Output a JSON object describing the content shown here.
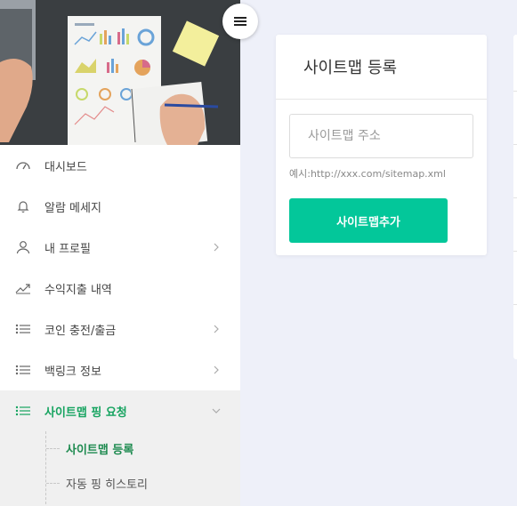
{
  "sidebar": {
    "items": [
      {
        "label": "대시보드",
        "icon": "dashboard-gauge-icon",
        "has_chevron": false
      },
      {
        "label": "알람 메세지",
        "icon": "bell-icon",
        "has_chevron": false
      },
      {
        "label": "내 프로필",
        "icon": "user-icon",
        "has_chevron": true
      },
      {
        "label": "수익지출 내역",
        "icon": "trend-line-icon",
        "has_chevron": false
      },
      {
        "label": "코인 충전/출금",
        "icon": "list-icon",
        "has_chevron": true
      },
      {
        "label": "백링크 정보",
        "icon": "list-icon",
        "has_chevron": true
      },
      {
        "label": "사이트맵 핑 요청",
        "icon": "list-icon",
        "has_chevron": true,
        "expanded": true,
        "active": true
      }
    ],
    "submenu": [
      {
        "label": "사이트맵 등록",
        "current": true
      },
      {
        "label": "자동 핑 히스토리",
        "current": false
      }
    ]
  },
  "card": {
    "title": "사이트맵 등록",
    "input_placeholder": "사이트맵 주소",
    "input_value": "",
    "hint": "예시:http://xxx.com/sitemap.xml",
    "button_label": "사이트맵추가"
  },
  "colors": {
    "accent": "#03c79a",
    "active_text": "#15a35f",
    "page_bg": "#eef0f9"
  }
}
